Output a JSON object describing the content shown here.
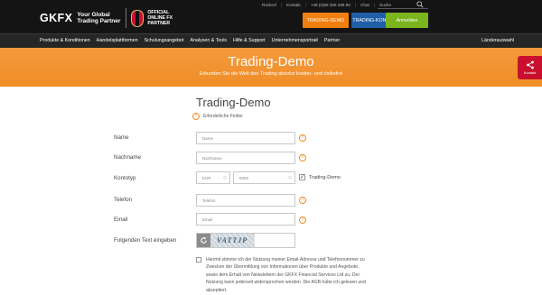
{
  "brand": {
    "logo_text": "GKFX",
    "tagline_1": "Your Global",
    "tagline_2": "Trading Partner",
    "partner_1": "OFFICIAL",
    "partner_2": "ONLINE FX",
    "partner_3": "PARTNER"
  },
  "utility": {
    "callback": "Rückruf",
    "contact": "Kontakt",
    "phone": "+49 (0)69 256 286 90",
    "chat": "Chat",
    "search": "Suche"
  },
  "buttons": {
    "demo": "TRADING-DEMO",
    "konto": "TRADING-KONTO",
    "login": "Anmelden"
  },
  "nav": {
    "items": [
      "Produkte & Konditionen",
      "Handelsplattformen",
      "Schulungsangebot",
      "Analysen & Tools",
      "Hilfe & Support",
      "Unternehmensportrait",
      "Partner"
    ],
    "country": "Länderauswahl"
  },
  "banner": {
    "title": "Trading-Demo",
    "subtitle": "Erkunden Sie die Welt des Trading absolut kosten- und risikofrei"
  },
  "kontakt_label": "Kontakt",
  "form": {
    "title": "Trading-Demo",
    "required_hint": "Erforderliche Felder",
    "name_label": "Name",
    "name_placeholder": "Name",
    "lastname_label": "Nachname",
    "lastname_placeholder": "Nachname",
    "account_label": "Kontotyp",
    "currency": "EUR",
    "amount": "5000",
    "demo_check_label": "Trading-Demo",
    "phone_label": "Telefon",
    "phone_placeholder": "Telefon",
    "email_label": "Email",
    "email_placeholder": "Email",
    "captcha_label": "Folgenden Text eingeben",
    "captcha_text": "VATTJP",
    "consent": "Hiermit stimme ich der Nutzung meiner Email-Adresse und Telefonnummer zu Zwecken der Übermittlung von Informationen über Produkte und Angebote, sowie dem Erhalt von Newslettern der GKFX Financial Services Ltd zu. Der Nutzung kann jederzeit widersprochen werden. Die AGB habe ich gelesen und akzeptiert."
  },
  "colors": {
    "orange": "#f08d27",
    "blue": "#1f5fa8",
    "green": "#7ab51d",
    "kontakt_red": "#c8102e"
  }
}
